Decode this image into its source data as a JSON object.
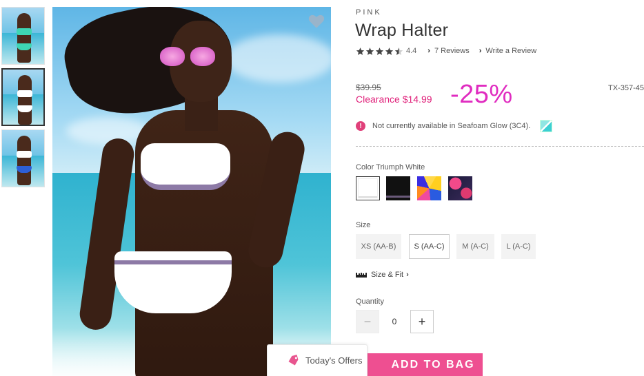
{
  "gallery": {
    "thumbnails": [
      {
        "top_color": "#3ed6b4",
        "bottom_color": "#3ed6b4"
      },
      {
        "top_color": "#ffffff",
        "bottom_color": "#ffffff"
      },
      {
        "top_color": "#ffffff",
        "bottom_color": "#2d5fd6"
      }
    ],
    "active_index": 1
  },
  "product": {
    "brand": "PINK",
    "title": "Wrap Halter",
    "rating": "4.4",
    "rating_value": 4.4,
    "reviews_link": "7 Reviews",
    "write_review_link": "Write a Review",
    "old_price": "$39.95",
    "clearance_price": "Clearance $14.99",
    "discount": "-25%",
    "sku": "TX-357-45",
    "availability": "Not currently available in Seafoam Glow (3C4).",
    "color_label": "Color Triumph White",
    "swatches": [
      {
        "name": "Triumph White",
        "selected": true
      },
      {
        "name": "Black"
      },
      {
        "name": "Multi Print"
      },
      {
        "name": "Tropical Print"
      }
    ],
    "size_label": "Size",
    "sizes": [
      "XS (AA-B)",
      "S (AA-C)",
      "M (A-C)",
      "L (A-C)"
    ],
    "selected_size": "S (AA-C)",
    "size_fit_link": "Size & Fit",
    "quantity_label": "Quantity",
    "quantity_value": "0",
    "quantity_minus": "−",
    "quantity_plus": "+",
    "add_to_bag": "ADD TO BAG"
  },
  "offers": {
    "label": "Today's Offers"
  },
  "colors": {
    "accent_pink": "#ee4f91",
    "discount_pink": "#e02cc0",
    "clearance_red": "#e0207a"
  },
  "icons": [
    "heart-icon",
    "star-icon",
    "chevron-right-icon",
    "alert-icon",
    "ruler-icon",
    "tag-icon"
  ]
}
